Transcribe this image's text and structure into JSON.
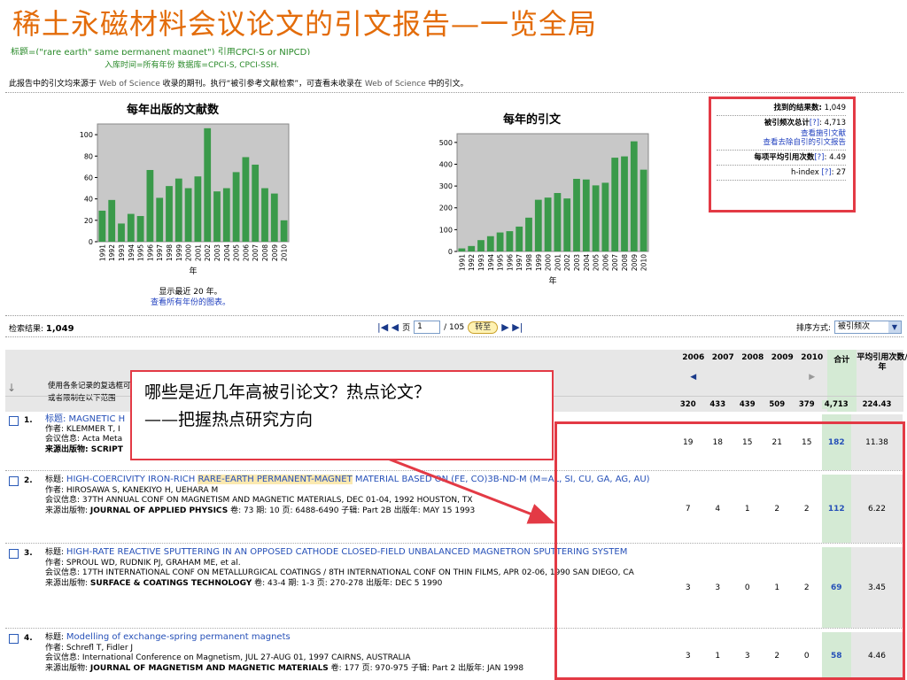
{
  "slide_title": "稀土永磁材料会议论文的引文报告—一览全局",
  "search_query_partial": "标题=(\"rare earth\" same permanent magnet\") 引用CPCI-S or NIPCD)",
  "search_meta": "入库时间=所有年份 数据库=CPCI-S, CPCI-SSH.",
  "source_note": {
    "prefix": "此报告中的引文均来源于",
    "wos1": "Web of Science",
    "mid": "收录的期刊。执行“被引参考文献检索”，可查看未收录在",
    "wos2": "Web of Science",
    "suffix": "中的引文。"
  },
  "stats": {
    "results_label": "找到的结果数:",
    "results_value": "1,049",
    "cited_label": "被引频次总计",
    "cited_help": "[?]",
    "cited_value": "4,713",
    "link_cited_articles": "查看施引文献",
    "link_without_self": "查看去除自引的引文报告",
    "avg_label": "每项平均引用次数",
    "avg_help": "[?]",
    "avg_value": "4.49",
    "h_label": "h-index",
    "h_help": "[?]",
    "h_value": "27"
  },
  "chart_data": [
    {
      "type": "bar",
      "title": "每年出版的文献数",
      "xlabel": "年",
      "ylabel": "",
      "categories": [
        "1991",
        "1992",
        "1993",
        "1994",
        "1995",
        "1996",
        "1997",
        "1998",
        "1999",
        "2000",
        "2001",
        "2002",
        "2003",
        "2004",
        "2005",
        "2006",
        "2007",
        "2008",
        "2009",
        "2010"
      ],
      "values": [
        29,
        39,
        17,
        26,
        24,
        67,
        41,
        52,
        59,
        50,
        61,
        106,
        47,
        50,
        65,
        79,
        72,
        50,
        45,
        20
      ],
      "ylim": [
        0,
        110
      ],
      "yticks": [
        0,
        20,
        40,
        60,
        80,
        100
      ],
      "color": "#3a9a4a"
    },
    {
      "type": "bar",
      "title": "每年的引文",
      "xlabel": "年",
      "ylabel": "",
      "categories": [
        "1991",
        "1992",
        "1993",
        "1994",
        "1995",
        "1996",
        "1997",
        "1998",
        "1999",
        "2000",
        "2001",
        "2002",
        "2003",
        "2004",
        "2005",
        "2006",
        "2007",
        "2008",
        "2009",
        "2010"
      ],
      "values": [
        14,
        25,
        52,
        70,
        87,
        93,
        114,
        155,
        237,
        247,
        268,
        243,
        333,
        330,
        303,
        315,
        430,
        436,
        505,
        375
      ],
      "ylim": [
        0,
        540
      ],
      "yticks": [
        0,
        100,
        200,
        300,
        400,
        500
      ],
      "color": "#3a9a4a"
    }
  ],
  "chart_note": {
    "recent": "显示最近 20 年。",
    "all_link": "查看所有年份的图表。"
  },
  "results_bar": {
    "label": "检索结果:",
    "count": "1,049",
    "page_label": "页",
    "page_value": "1",
    "page_total": "/ 105",
    "go_label": "转至",
    "first_prev": "|◀ ◀",
    "next_last": "▶ ▶|",
    "sort_label": "排序方式:",
    "sort_value": "被引频次"
  },
  "table_header": {
    "instr1": "使用各条记录的复选框可以从此引文报告中删除各条记录",
    "instr2": "或者限制在以下范围",
    "years": [
      "2006",
      "2007",
      "2008",
      "2009",
      "2010"
    ],
    "total_label": "合计",
    "avg_label": "平均引用次数/年",
    "sums": [
      "320",
      "433",
      "439",
      "509",
      "379",
      "4,713",
      "224.43"
    ],
    "prev_arrow": "◀",
    "next_arrow": "▶"
  },
  "records": [
    {
      "num": "1.",
      "title_pre": "标题: MAGNETIC H",
      "authors": "作者: KLEMMER T, I",
      "conf": "会议信息: Acta Meta",
      "source": "来源出版物: SCRIPT",
      "cites": [
        "19",
        "18",
        "15",
        "21",
        "15"
      ],
      "total": "182",
      "avg": "11.38"
    },
    {
      "num": "2.",
      "title_label": "标题:",
      "title_a": "HIGH-COERCIVITY IRON-RICH",
      "title_hl": "RARE-EARTH PERMANENT-MAGNET",
      "title_b": "MATERIAL BASED ON (FE, CO)3B-ND-M (M=AL, SI, CU, GA, AG, AU)",
      "authors": "作者: HIROSAWA S, KANEKIYO H, UEHARA M",
      "conf": "会议信息: 37TH ANNUAL CONF ON MAGNETISM AND MAGNETIC MATERIALS, DEC 01-04, 1992 HOUSTON, TX",
      "source_label": "来源出版物:",
      "source_name": "JOURNAL OF APPLIED PHYSICS",
      "source_rest": "卷: 73  期: 10  页: 6488-6490  子辑: Part 2B  出版年: MAY 15 1993",
      "cites": [
        "7",
        "4",
        "1",
        "2",
        "2"
      ],
      "total": "112",
      "avg": "6.22"
    },
    {
      "num": "3.",
      "title_label": "标题:",
      "title_a": "HIGH-RATE REACTIVE SPUTTERING IN AN OPPOSED CATHODE CLOSED-FIELD UNBALANCED MAGNETRON SPUTTERING SYSTEM",
      "authors": "作者: SPROUL WD, RUDNIK PJ, GRAHAM ME, et al.",
      "conf": "会议信息: 17TH INTERNATIONAL CONF ON METALLURGICAL COATINGS / 8TH INTERNATIONAL CONF ON THIN FILMS, APR 02-06, 1990 SAN DIEGO, CA",
      "source_label": "来源出版物:",
      "source_name": "SURFACE & COATINGS TECHNOLOGY",
      "source_rest": "卷: 43-4  期: 1-3  页: 270-278  出版年: DEC 5 1990",
      "cites": [
        "3",
        "3",
        "0",
        "1",
        "2"
      ],
      "total": "69",
      "avg": "3.45"
    },
    {
      "num": "4.",
      "title_label": "标题:",
      "title_a": "Modelling of exchange-spring permanent magnets",
      "authors": "作者: Schrefl T, Fidler J",
      "conf": "会议信息: International Conference on Magnetism, JUL 27-AUG 01, 1997 CAIRNS, AUSTRALIA",
      "source_label": "来源出版物:",
      "source_name": "JOURNAL OF MAGNETISM AND MAGNETIC MATERIALS",
      "source_rest": "卷: 177  页: 970-975  子辑: Part 2  出版年: JAN 1998",
      "cites": [
        "3",
        "1",
        "3",
        "2",
        "0"
      ],
      "total": "58",
      "avg": "4.46"
    }
  ],
  "callout": {
    "line1": "哪些是近几年高被引论文？热点论文？",
    "line2": "——把握热点研究方向"
  },
  "colors": {
    "title_orange": "#e36c0a",
    "annotation_red": "#e33a45",
    "bar_green": "#3a9a4a",
    "link_blue": "#2650b8"
  }
}
